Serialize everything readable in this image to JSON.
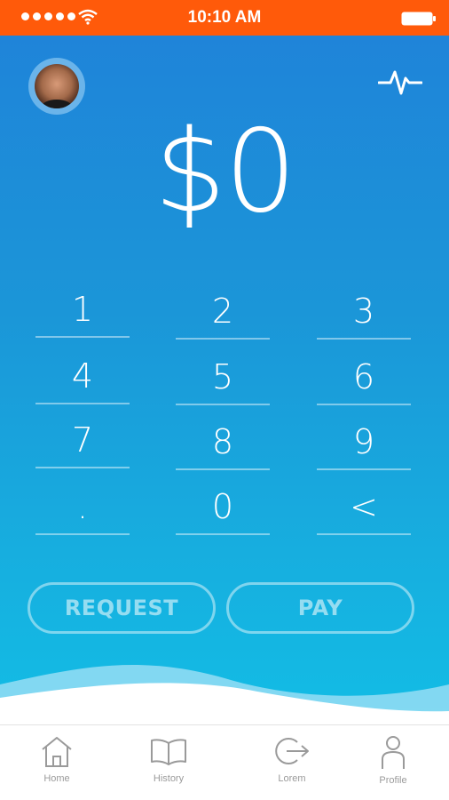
{
  "status_bar": {
    "time": "10:10 AM",
    "signal_icon": "signal-dots-icon",
    "wifi_icon": "wifi-icon",
    "battery_icon": "battery-icon",
    "background_color": "#ff5a0a"
  },
  "header": {
    "avatar_icon": "avatar",
    "activity_icon": "activity-pulse-icon"
  },
  "amount": {
    "value": "$0"
  },
  "keypad": {
    "keys": [
      "1",
      "2",
      "3",
      "4",
      "5",
      "6",
      "7",
      "8",
      "9",
      ".",
      "0",
      "<"
    ]
  },
  "actions": {
    "request_label": "REQUEST",
    "pay_label": "PAY"
  },
  "tab_bar": {
    "tabs": [
      {
        "label": "Home",
        "icon": "home-icon"
      },
      {
        "label": "History",
        "icon": "book-icon"
      },
      {
        "label": "Lorem",
        "icon": "logout-icon"
      },
      {
        "label": "Profile",
        "icon": "person-icon"
      }
    ]
  },
  "colors": {
    "accent": "#ff5a0a",
    "primary_blue": "#1f84d9",
    "light_blue": "#12bde5"
  }
}
